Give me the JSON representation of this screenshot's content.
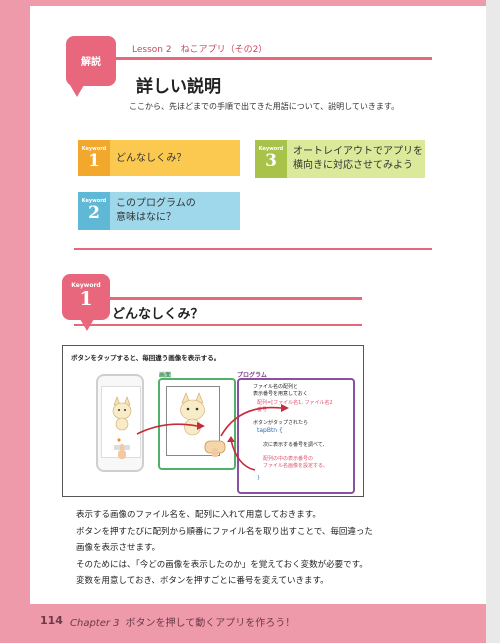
{
  "lesson": {
    "tag": "解説",
    "label": "Lesson 2　ねこアプリ（その2）"
  },
  "section": {
    "title": "詳しい説明",
    "intro": "ここから、先ほどまでの手順で出てきた用語について、説明していきます。"
  },
  "keywords": [
    {
      "kw": "Keyword",
      "num": "1",
      "text": "どんなしくみ？"
    },
    {
      "kw": "Keyword",
      "num": "3",
      "text_line1": "オートレイアウトでアプリを",
      "text_line2": "横向きに対応させてみよう"
    },
    {
      "kw": "Keyword",
      "num": "2",
      "text_line1": "このプログラムの",
      "text_line2": "意味はなに？"
    }
  ],
  "kw1_section": {
    "kw": "Keyword",
    "num": "1",
    "title": "どんなしくみ？"
  },
  "figure": {
    "caption": "ボタンをタップすると、毎回違う画像を表示する。",
    "screen_label": "画面",
    "program_label": "プログラム",
    "program_lines": [
      "ファイル名の配列と",
      "表示番号を用意しておく",
      "配列=[ファイル名1, ファイル名2",
      "番号",
      "ボタンがタップされたら",
      "tapBtn {",
      "次に表示する番号を調べて、",
      "配列の中の表示番号の",
      "ファイル名画像を設定する。",
      "}"
    ]
  },
  "body": [
    "表示する画像のファイル名を、配列に入れて用意しておきます。",
    "ボタンを押すたびに配列から順番にファイル名を取り出すことで、毎回違った",
    "画像を表示させます。",
    "そのためには、「今どの画像を表示したのか」を覚えておく変数が必要です。",
    "変数を用意しておき、ボタンを押すごとに番号を変えていきます。"
  ],
  "footer": {
    "page": "114",
    "chapter": "Chapter 3",
    "chapter_title": "ボタンを押して動くアプリを作ろう！"
  },
  "colors": {
    "pink": "#e8677c",
    "orange": "#fbc94f",
    "green": "#dbe99a",
    "blue": "#9ed8ea"
  }
}
